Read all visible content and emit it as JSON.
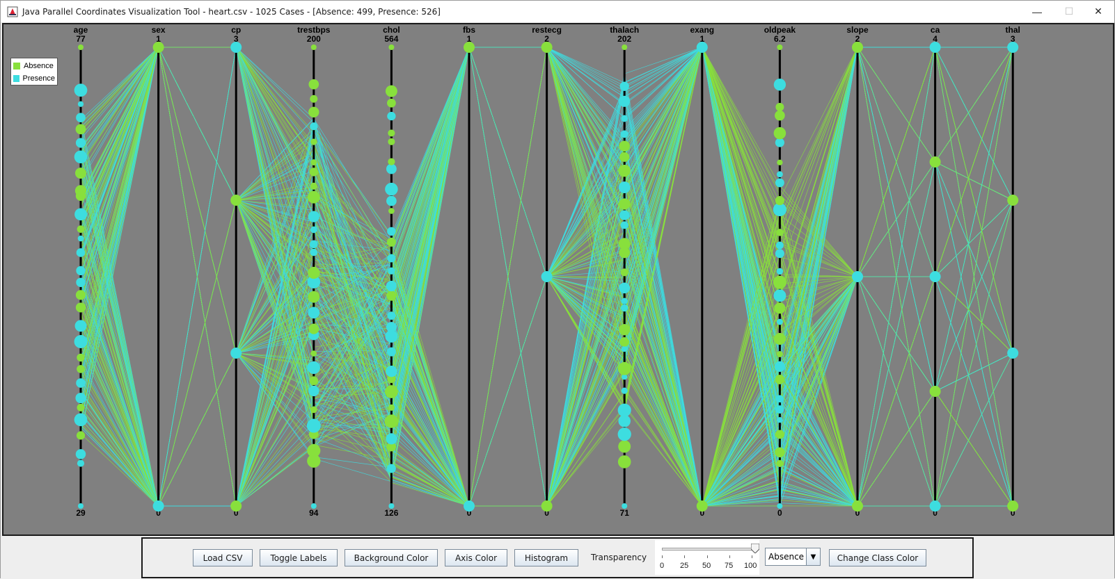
{
  "window": {
    "title": "Java Parallel Coordinates Visualization Tool - heart.csv - 1025 Cases - [Absence: 499, Presence: 526]",
    "minimize": "—",
    "maximize": "☐",
    "close": "✕"
  },
  "colors": {
    "absence": "#88e03c",
    "presence": "#3ddde0",
    "background": "#808080",
    "axis": "#000000"
  },
  "legend": [
    {
      "label": "Absence",
      "color": "#88e03c"
    },
    {
      "label": "Presence",
      "color": "#3ddde0"
    }
  ],
  "axes": [
    {
      "name": "age",
      "max": "77",
      "min": "29"
    },
    {
      "name": "sex",
      "max": "1",
      "min": "0"
    },
    {
      "name": "cp",
      "max": "3",
      "min": "0"
    },
    {
      "name": "trestbps",
      "max": "200",
      "min": "94"
    },
    {
      "name": "chol",
      "max": "564",
      "min": "126"
    },
    {
      "name": "fbs",
      "max": "1",
      "min": "0"
    },
    {
      "name": "restecg",
      "max": "2",
      "min": "0"
    },
    {
      "name": "thalach",
      "max": "202",
      "min": "71"
    },
    {
      "name": "exang",
      "max": "1",
      "min": "0"
    },
    {
      "name": "oldpeak",
      "max": "6.2",
      "min": "0"
    },
    {
      "name": "slope",
      "max": "2",
      "min": "0"
    },
    {
      "name": "ca",
      "max": "4",
      "min": "0"
    },
    {
      "name": "thal",
      "max": "3",
      "min": "0"
    }
  ],
  "toolbar": {
    "load_csv": "Load CSV",
    "toggle_labels": "Toggle Labels",
    "background_color": "Background Color",
    "axis_color": "Axis Color",
    "histogram": "Histogram",
    "transparency_label": "Transparency",
    "transparency_value": 100,
    "transparency_ticks": [
      "0",
      "25",
      "50",
      "75",
      "100"
    ],
    "class_selected": "Absence",
    "change_class_color": "Change Class Color"
  }
}
